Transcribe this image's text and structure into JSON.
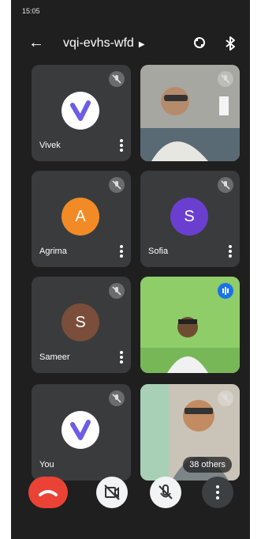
{
  "status_bar": {
    "time": "15:05",
    "left_text": " ",
    "right_text": " "
  },
  "app_bar": {
    "meeting_code": "vqi-evhs-wfd"
  },
  "participants": [
    {
      "name": "Vivek",
      "tile": "avatar-logo",
      "muted": true
    },
    {
      "name": "",
      "tile": "video",
      "muted": true
    },
    {
      "name": "Agrima",
      "tile": "avatar-initial",
      "initial": "A",
      "color": "#f28b26",
      "muted": true
    },
    {
      "name": "Sofia",
      "tile": "avatar-initial",
      "initial": "S",
      "color": "#6a3fd0",
      "muted": true
    },
    {
      "name": "Sameer",
      "tile": "avatar-initial",
      "initial": "S",
      "color": "#7a4e3a",
      "muted": true
    },
    {
      "name": "",
      "tile": "video",
      "speaking": true
    },
    {
      "name": "You",
      "tile": "avatar-logo",
      "muted": true
    },
    {
      "name": "",
      "tile": "video",
      "muted": true,
      "overflow_label": "38 others"
    }
  ],
  "controls": [
    "end-call",
    "camera-off",
    "mic-off",
    "more-options"
  ],
  "colors": {
    "end_call": "#ea4335",
    "tile_bg": "#3a3b3d",
    "speaking": "#1a73e8"
  }
}
